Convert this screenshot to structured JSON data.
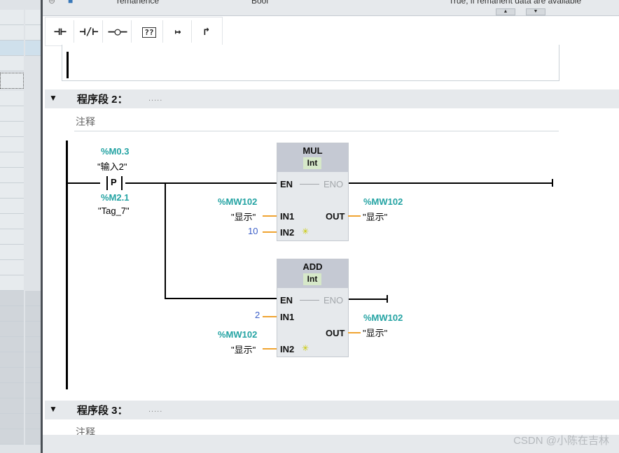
{
  "header_strip": {
    "col1": "remanence",
    "col2": "Bool",
    "col3": "True, if remanent data are available"
  },
  "toolbar": {
    "buttons": [
      {
        "name": "normally-open-contact",
        "glyph": "-| |-"
      },
      {
        "name": "normally-closed-contact",
        "glyph": "-|/|-"
      },
      {
        "name": "output-coil",
        "glyph": "-( )-"
      },
      {
        "name": "empty-box",
        "glyph": "??"
      },
      {
        "name": "open-branch",
        "glyph": "↦"
      },
      {
        "name": "close-branch",
        "glyph": "↱"
      }
    ]
  },
  "network2": {
    "title": "程序段 2：",
    "dots": ".....",
    "comment": "注释",
    "contact": {
      "type_label": "P",
      "address": "%M0.3",
      "name": "\"输入2\"",
      "edge_address": "%M2.1",
      "edge_name": "\"Tag_7\""
    },
    "mul": {
      "name": "MUL",
      "type": "Int",
      "en": "EN",
      "eno": "ENO",
      "in1": "IN1",
      "in2": "IN2",
      "out": "OUT",
      "in1_addr": "%MW102",
      "in1_name": "\"显示\"",
      "in2_const": "10",
      "out_addr": "%MW102",
      "out_name": "\"显示\""
    },
    "add": {
      "name": "ADD",
      "type": "Int",
      "en": "EN",
      "eno": "ENO",
      "in1": "IN1",
      "in2": "IN2",
      "out": "OUT",
      "in1_const": "2",
      "in2_addr": "%MW102",
      "in2_name": "\"显示\"",
      "out_addr": "%MW102",
      "out_name": "\"显示\""
    }
  },
  "network3": {
    "title": "程序段 3：",
    "dots": ".....",
    "comment": "注释"
  },
  "watermark": "CSDN @小陈在吉林",
  "colors": {
    "address": "#24a3a3",
    "wire": "#f0a431",
    "constant": "#3c5fc8",
    "block_header": "#c5c9d3",
    "type_badge": "#d6e8c9"
  }
}
